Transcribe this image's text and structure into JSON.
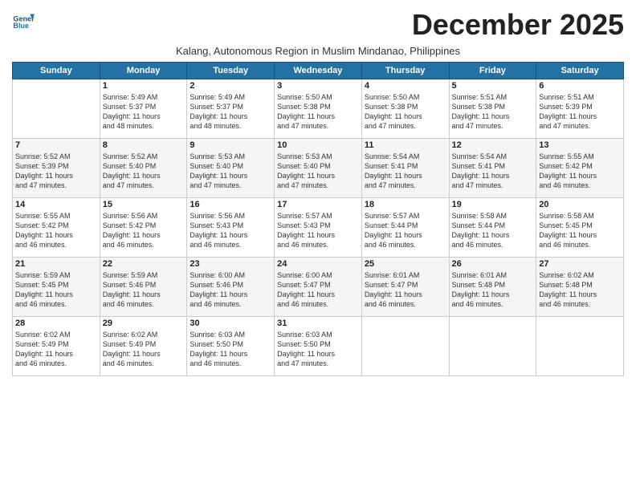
{
  "logo": {
    "line1": "General",
    "line2": "Blue"
  },
  "title": "December 2025",
  "subtitle": "Kalang, Autonomous Region in Muslim Mindanao, Philippines",
  "days_of_week": [
    "Sunday",
    "Monday",
    "Tuesday",
    "Wednesday",
    "Thursday",
    "Friday",
    "Saturday"
  ],
  "weeks": [
    [
      {
        "day": "",
        "info": ""
      },
      {
        "day": "1",
        "info": "Sunrise: 5:49 AM\nSunset: 5:37 PM\nDaylight: 11 hours\nand 48 minutes."
      },
      {
        "day": "2",
        "info": "Sunrise: 5:49 AM\nSunset: 5:37 PM\nDaylight: 11 hours\nand 48 minutes."
      },
      {
        "day": "3",
        "info": "Sunrise: 5:50 AM\nSunset: 5:38 PM\nDaylight: 11 hours\nand 47 minutes."
      },
      {
        "day": "4",
        "info": "Sunrise: 5:50 AM\nSunset: 5:38 PM\nDaylight: 11 hours\nand 47 minutes."
      },
      {
        "day": "5",
        "info": "Sunrise: 5:51 AM\nSunset: 5:38 PM\nDaylight: 11 hours\nand 47 minutes."
      },
      {
        "day": "6",
        "info": "Sunrise: 5:51 AM\nSunset: 5:39 PM\nDaylight: 11 hours\nand 47 minutes."
      }
    ],
    [
      {
        "day": "7",
        "info": "Sunrise: 5:52 AM\nSunset: 5:39 PM\nDaylight: 11 hours\nand 47 minutes."
      },
      {
        "day": "8",
        "info": "Sunrise: 5:52 AM\nSunset: 5:40 PM\nDaylight: 11 hours\nand 47 minutes."
      },
      {
        "day": "9",
        "info": "Sunrise: 5:53 AM\nSunset: 5:40 PM\nDaylight: 11 hours\nand 47 minutes."
      },
      {
        "day": "10",
        "info": "Sunrise: 5:53 AM\nSunset: 5:40 PM\nDaylight: 11 hours\nand 47 minutes."
      },
      {
        "day": "11",
        "info": "Sunrise: 5:54 AM\nSunset: 5:41 PM\nDaylight: 11 hours\nand 47 minutes."
      },
      {
        "day": "12",
        "info": "Sunrise: 5:54 AM\nSunset: 5:41 PM\nDaylight: 11 hours\nand 47 minutes."
      },
      {
        "day": "13",
        "info": "Sunrise: 5:55 AM\nSunset: 5:42 PM\nDaylight: 11 hours\nand 46 minutes."
      }
    ],
    [
      {
        "day": "14",
        "info": "Sunrise: 5:55 AM\nSunset: 5:42 PM\nDaylight: 11 hours\nand 46 minutes."
      },
      {
        "day": "15",
        "info": "Sunrise: 5:56 AM\nSunset: 5:42 PM\nDaylight: 11 hours\nand 46 minutes."
      },
      {
        "day": "16",
        "info": "Sunrise: 5:56 AM\nSunset: 5:43 PM\nDaylight: 11 hours\nand 46 minutes."
      },
      {
        "day": "17",
        "info": "Sunrise: 5:57 AM\nSunset: 5:43 PM\nDaylight: 11 hours\nand 46 minutes."
      },
      {
        "day": "18",
        "info": "Sunrise: 5:57 AM\nSunset: 5:44 PM\nDaylight: 11 hours\nand 46 minutes."
      },
      {
        "day": "19",
        "info": "Sunrise: 5:58 AM\nSunset: 5:44 PM\nDaylight: 11 hours\nand 46 minutes."
      },
      {
        "day": "20",
        "info": "Sunrise: 5:58 AM\nSunset: 5:45 PM\nDaylight: 11 hours\nand 46 minutes."
      }
    ],
    [
      {
        "day": "21",
        "info": "Sunrise: 5:59 AM\nSunset: 5:45 PM\nDaylight: 11 hours\nand 46 minutes."
      },
      {
        "day": "22",
        "info": "Sunrise: 5:59 AM\nSunset: 5:46 PM\nDaylight: 11 hours\nand 46 minutes."
      },
      {
        "day": "23",
        "info": "Sunrise: 6:00 AM\nSunset: 5:46 PM\nDaylight: 11 hours\nand 46 minutes."
      },
      {
        "day": "24",
        "info": "Sunrise: 6:00 AM\nSunset: 5:47 PM\nDaylight: 11 hours\nand 46 minutes."
      },
      {
        "day": "25",
        "info": "Sunrise: 6:01 AM\nSunset: 5:47 PM\nDaylight: 11 hours\nand 46 minutes."
      },
      {
        "day": "26",
        "info": "Sunrise: 6:01 AM\nSunset: 5:48 PM\nDaylight: 11 hours\nand 46 minutes."
      },
      {
        "day": "27",
        "info": "Sunrise: 6:02 AM\nSunset: 5:48 PM\nDaylight: 11 hours\nand 46 minutes."
      }
    ],
    [
      {
        "day": "28",
        "info": "Sunrise: 6:02 AM\nSunset: 5:49 PM\nDaylight: 11 hours\nand 46 minutes."
      },
      {
        "day": "29",
        "info": "Sunrise: 6:02 AM\nSunset: 5:49 PM\nDaylight: 11 hours\nand 46 minutes."
      },
      {
        "day": "30",
        "info": "Sunrise: 6:03 AM\nSunset: 5:50 PM\nDaylight: 11 hours\nand 46 minutes."
      },
      {
        "day": "31",
        "info": "Sunrise: 6:03 AM\nSunset: 5:50 PM\nDaylight: 11 hours\nand 47 minutes."
      },
      {
        "day": "",
        "info": ""
      },
      {
        "day": "",
        "info": ""
      },
      {
        "day": "",
        "info": ""
      }
    ]
  ]
}
